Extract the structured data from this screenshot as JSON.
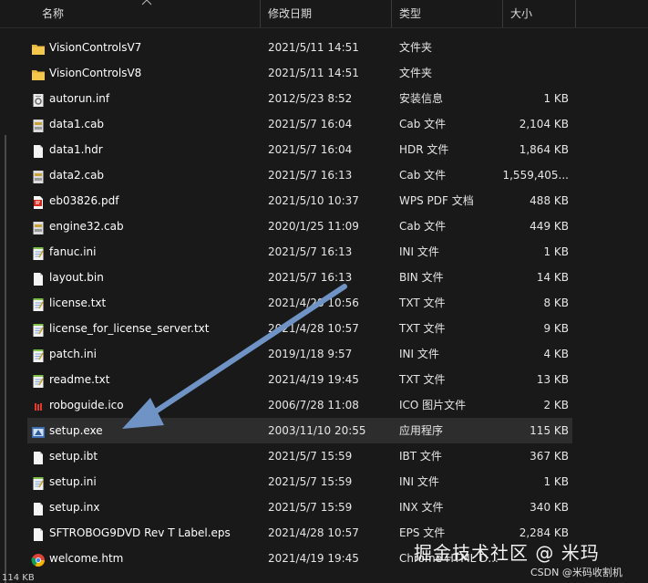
{
  "columns": {
    "name": "名称",
    "date": "修改日期",
    "type": "类型",
    "size": "大小"
  },
  "files": [
    {
      "name": "VisionControlsV7",
      "date": "2021/5/11 14:51",
      "type": "文件夹",
      "size": "",
      "icon": "folder-icon"
    },
    {
      "name": "VisionControlsV8",
      "date": "2021/5/11 14:51",
      "type": "文件夹",
      "size": "",
      "icon": "folder-icon"
    },
    {
      "name": "autorun.inf",
      "date": "2012/5/23 8:52",
      "type": "安装信息",
      "size": "1 KB",
      "icon": "settings-file-icon"
    },
    {
      "name": "data1.cab",
      "date": "2021/5/7 16:04",
      "type": "Cab 文件",
      "size": "2,104 KB",
      "icon": "cab-file-icon"
    },
    {
      "name": "data1.hdr",
      "date": "2021/5/7 16:04",
      "type": "HDR 文件",
      "size": "1,864 KB",
      "icon": "blank-file-icon"
    },
    {
      "name": "data2.cab",
      "date": "2021/5/7 16:13",
      "type": "Cab 文件",
      "size": "1,559,405...",
      "icon": "cab-file-icon"
    },
    {
      "name": "eb03826.pdf",
      "date": "2021/5/10 10:37",
      "type": "WPS PDF 文档",
      "size": "488 KB",
      "icon": "pdf-file-icon"
    },
    {
      "name": "engine32.cab",
      "date": "2020/1/25 11:09",
      "type": "Cab 文件",
      "size": "449 KB",
      "icon": "cab-file-icon"
    },
    {
      "name": "fanuc.ini",
      "date": "2021/5/7 16:13",
      "type": "INI 文件",
      "size": "1 KB",
      "icon": "notepad-file-icon"
    },
    {
      "name": "layout.bin",
      "date": "2021/5/7 16:13",
      "type": "BIN 文件",
      "size": "14 KB",
      "icon": "blank-file-icon"
    },
    {
      "name": "license.txt",
      "date": "2021/4/28 10:56",
      "type": "TXT 文件",
      "size": "8 KB",
      "icon": "notepad-file-icon"
    },
    {
      "name": "license_for_license_server.txt",
      "date": "2021/4/28 10:57",
      "type": "TXT 文件",
      "size": "9 KB",
      "icon": "notepad-file-icon"
    },
    {
      "name": "patch.ini",
      "date": "2019/1/18 9:57",
      "type": "INI 文件",
      "size": "4 KB",
      "icon": "notepad-file-icon"
    },
    {
      "name": "readme.txt",
      "date": "2021/4/19 19:45",
      "type": "TXT 文件",
      "size": "13 KB",
      "icon": "notepad-file-icon"
    },
    {
      "name": "roboguide.ico",
      "date": "2006/7/28 11:08",
      "type": "ICO 图片文件",
      "size": "2 KB",
      "icon": "robot-ico-icon"
    },
    {
      "name": "setup.exe",
      "date": "2003/11/10 20:55",
      "type": "应用程序",
      "size": "115 KB",
      "icon": "setup-exe-icon"
    },
    {
      "name": "setup.ibt",
      "date": "2021/5/7 15:59",
      "type": "IBT 文件",
      "size": "367 KB",
      "icon": "blank-file-icon"
    },
    {
      "name": "setup.ini",
      "date": "2021/5/7 15:59",
      "type": "INI 文件",
      "size": "1 KB",
      "icon": "notepad-file-icon"
    },
    {
      "name": "setup.inx",
      "date": "2021/5/7 15:59",
      "type": "INX 文件",
      "size": "340 KB",
      "icon": "blank-file-icon"
    },
    {
      "name": "SFTROBOG9DVD Rev T Label.eps",
      "date": "2021/4/28 10:57",
      "type": "EPS 文件",
      "size": "2,284 KB",
      "icon": "blank-file-icon"
    },
    {
      "name": "welcome.htm",
      "date": "2021/4/19 19:45",
      "type": "Chrome HTML D...",
      "size": "",
      "icon": "chrome-icon"
    }
  ],
  "selected_file": "setup.exe",
  "status": {
    "count_text": "114 KB"
  },
  "watermark": {
    "main": "掘金技术社区 @ 米玛",
    "sub": "CSDN @米码收割机"
  }
}
